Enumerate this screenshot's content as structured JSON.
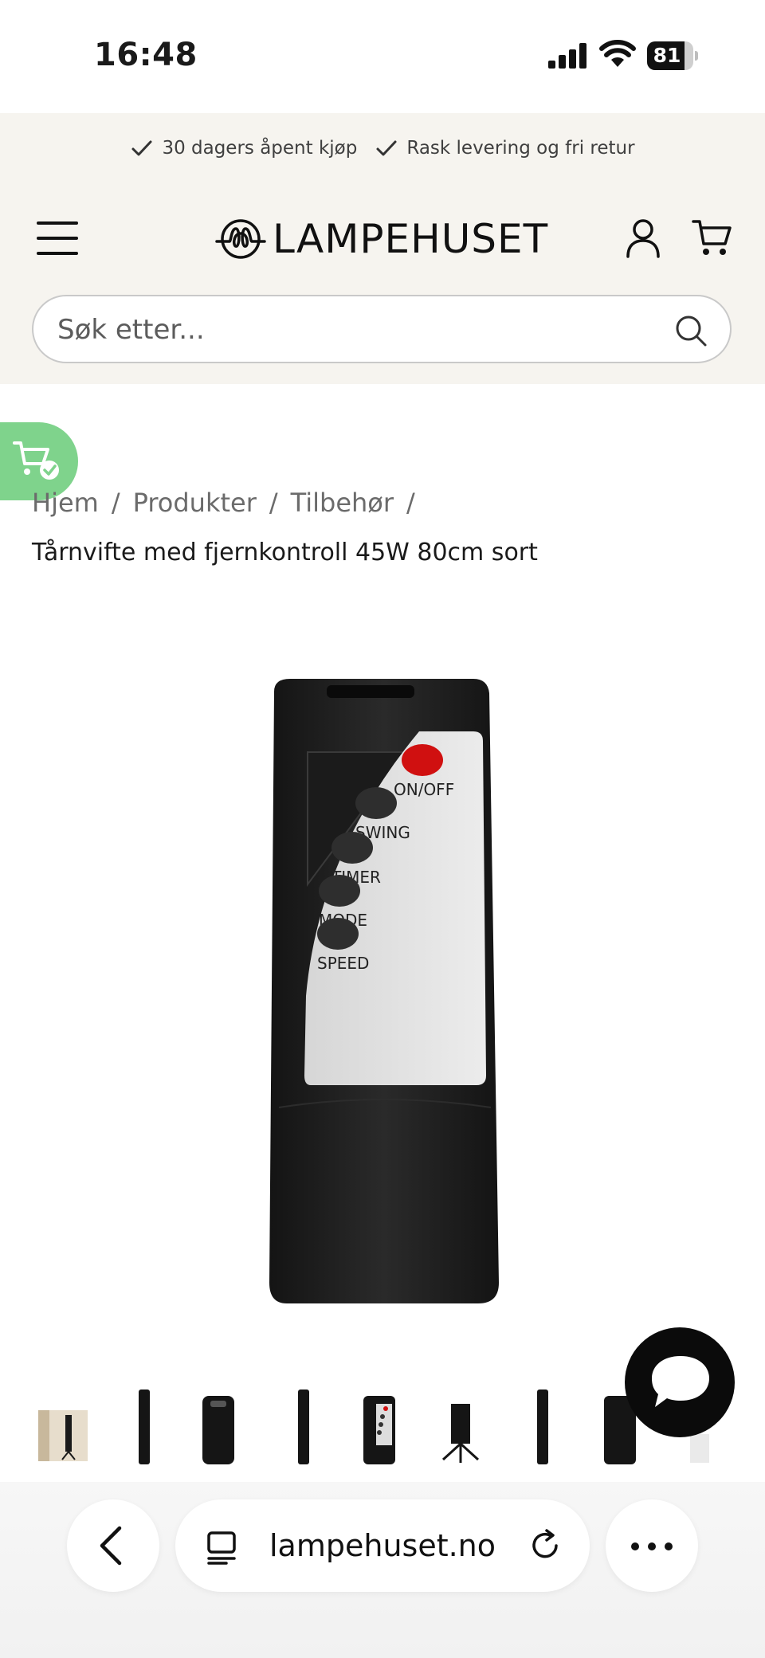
{
  "status_bar": {
    "time": "16:48",
    "battery": "81",
    "battery_fraction": 0.81
  },
  "usp": [
    {
      "label": "30 dagers åpent kjøp"
    },
    {
      "label": "Rask levering og fri retur"
    }
  ],
  "header": {
    "logo_text": "LAMPEHUSET"
  },
  "search": {
    "placeholder": "Søk etter..."
  },
  "breadcrumb": [
    "Hjem",
    "Produkter",
    "Tilbehør"
  ],
  "product": {
    "title": "Tårnvifte med fjernkontroll 45W 80cm sort",
    "remote_buttons": [
      "ON/OFF",
      "SWING",
      "TIMER",
      "MODE",
      "SPEED"
    ]
  },
  "browser": {
    "url": "lampehuset.no"
  },
  "colors": {
    "header_bg": "#f6f4ef",
    "cart_badge": "#7fd38c",
    "power_button": "#d01010"
  }
}
